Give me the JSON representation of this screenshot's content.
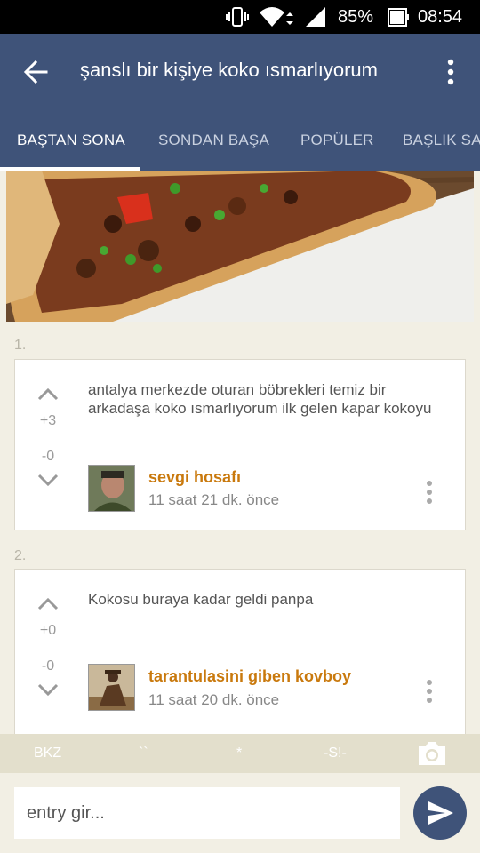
{
  "status_bar": {
    "battery": "85%",
    "time": "08:54"
  },
  "app_bar": {
    "title": "şanslı bir kişiye koko ısmarlıyorum",
    "tabs": [
      {
        "label": "BAŞTAN SONA",
        "active": true
      },
      {
        "label": "SONDAN BAŞA",
        "active": false
      },
      {
        "label": "POPÜLER",
        "active": false
      },
      {
        "label": "BAŞLIK SA",
        "active": false
      }
    ]
  },
  "entries": [
    {
      "number": "1.",
      "text": "antalya merkezde oturan böbrekleri temiz bir arkadaşa koko ısmarlıyorum ilk gelen kapar kokoyu",
      "upvotes": "+3",
      "downvotes": "-0",
      "author": "sevgi hosafı",
      "time": "11 saat 21 dk. önce"
    },
    {
      "number": "2.",
      "text": "Kokosu buraya kadar geldi panpa",
      "upvotes": "+0",
      "downvotes": "-0",
      "author": "tarantulasini giben kovboy",
      "time": "11 saat 20 dk. önce"
    }
  ],
  "format_bar": {
    "bkz": "BKZ",
    "backtick": "``",
    "star": "*",
    "spoiler": "-S!-"
  },
  "composer": {
    "placeholder": "entry gir..."
  },
  "colors": {
    "app_bar": "#3f5379",
    "author": "#c9790d",
    "background": "#f2efe4",
    "format_bar": "#e3dfcc"
  },
  "icons": [
    "back-arrow-icon",
    "more-vert-icon",
    "vote-up-icon",
    "vote-down-icon",
    "camera-icon",
    "send-icon",
    "wifi-icon",
    "signal-icon",
    "battery-icon",
    "vibrate-icon"
  ]
}
